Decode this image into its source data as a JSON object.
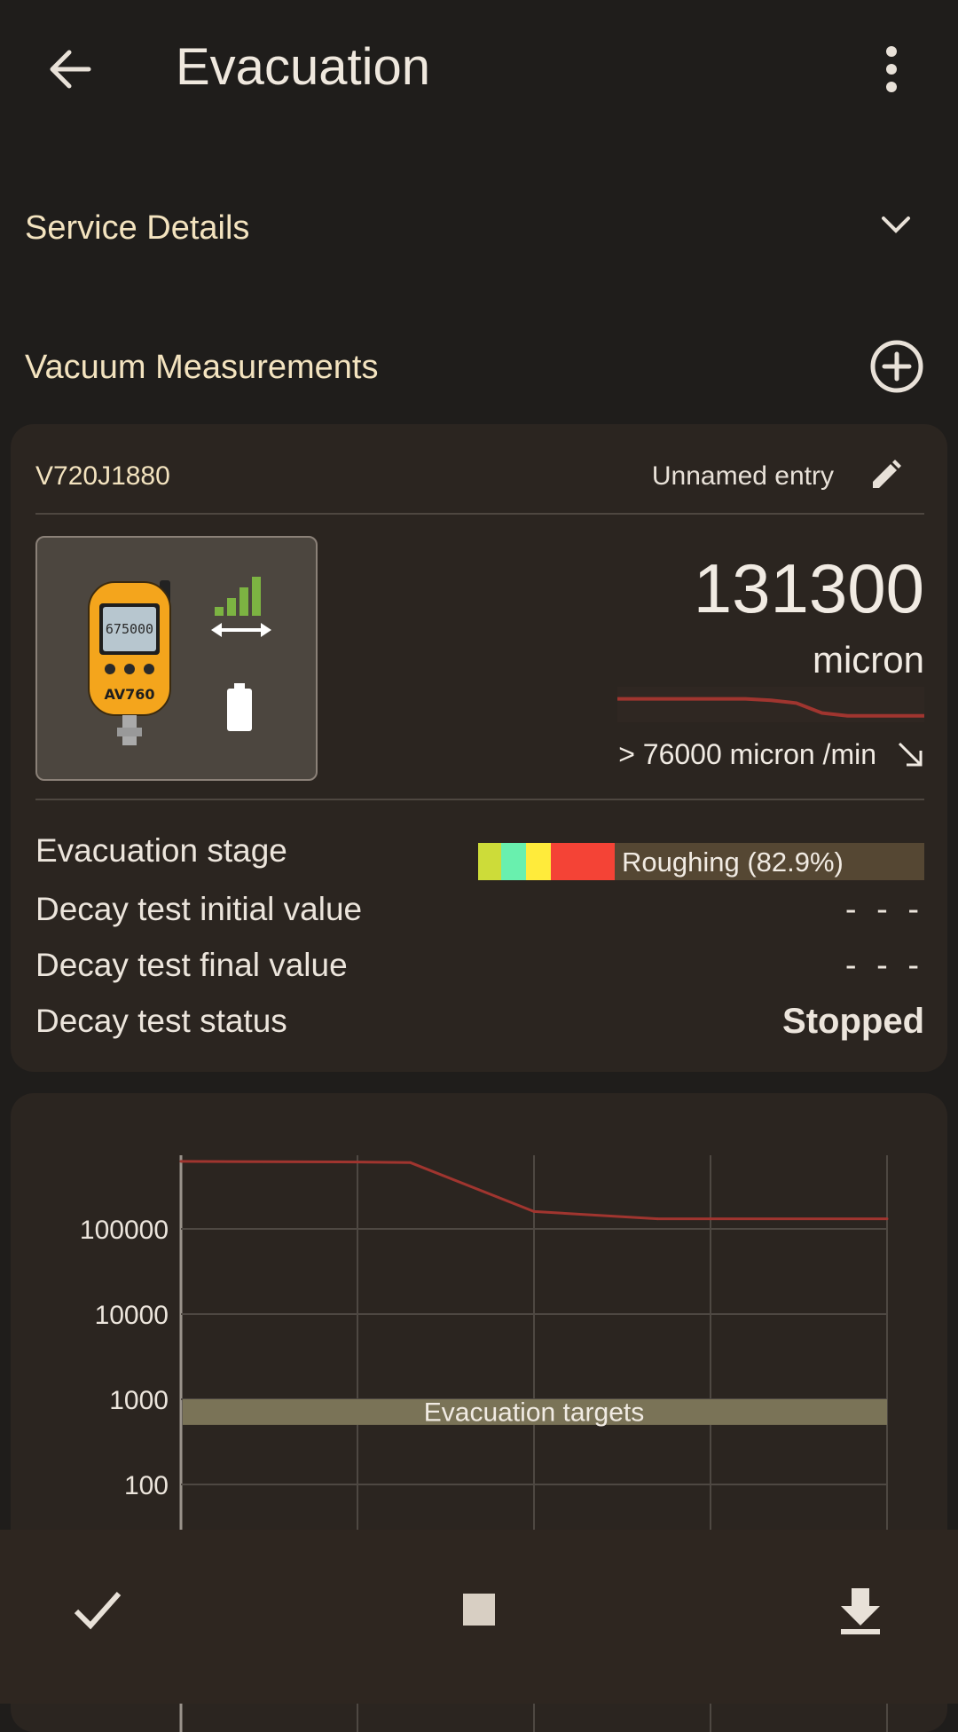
{
  "appbar": {
    "title": "Evacuation"
  },
  "sections": {
    "service_details": "Service Details",
    "vacuum_measurements": "Vacuum Measurements"
  },
  "measurement": {
    "serial": "V720J1880",
    "entry_name": "Unnamed entry",
    "device_screen_value": "675000",
    "device_model": "AV760",
    "signal_bars": 4,
    "reading": "131300",
    "unit": "micron",
    "rate": "> 76000 micron /min",
    "rate_trend_icon": "arrow-down-right-icon",
    "sparkline": [
      0.3,
      0.3,
      0.3,
      0.3,
      0.3,
      0.3,
      0.35,
      0.45,
      0.8,
      0.9,
      0.9,
      0.9,
      0.9
    ],
    "rows": {
      "evacuation_stage_label": "Evacuation stage",
      "evacuation_stage_value": "Roughing (82.9%)",
      "evacuation_stage_fraction": 0.829,
      "decay_initial_label": "Decay test initial value",
      "decay_initial_value": "- - -",
      "decay_final_label": "Decay test final value",
      "decay_final_value": "- - -",
      "decay_status_label": "Decay test status",
      "decay_status_value": "Stopped"
    },
    "stage_colors": [
      "#cddc39",
      "#69f0ae",
      "#ffeb3b",
      "#f44336"
    ]
  },
  "chart_data": {
    "type": "line",
    "title": "",
    "xlabel": "",
    "ylabel": "",
    "yscale": "log",
    "yticks": [
      "100000",
      "10000",
      "1000",
      "100"
    ],
    "x": [
      0,
      1,
      1.3,
      2,
      2.7,
      4
    ],
    "values": [
      620000,
      610000,
      600000,
      160000,
      131300,
      131300
    ],
    "line_color": "#a0352f",
    "target_band": {
      "label": "Evacuation targets",
      "low": 500,
      "high": 1000
    }
  },
  "bottom_bar": {
    "confirm_icon": "check-icon",
    "stop_icon": "stop-icon",
    "download_icon": "download-icon"
  }
}
